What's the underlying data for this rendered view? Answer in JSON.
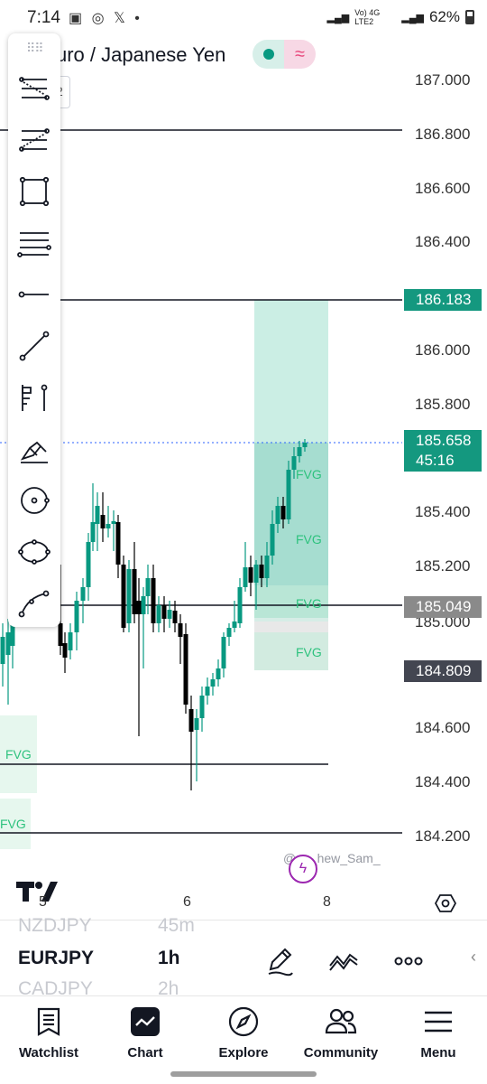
{
  "status_bar": {
    "time": "7:14",
    "signal_text": "Vo) 4G LTE2",
    "battery": "62%"
  },
  "symbol": {
    "title": "uro / Japanese Yen"
  },
  "price_axis": [
    "187.000",
    "186.800",
    "186.600",
    "186.400",
    "186.000",
    "185.800",
    "185.400",
    "185.200",
    "185.000",
    "184.600",
    "184.400",
    "184.200"
  ],
  "price_tags": {
    "target": "186.183",
    "current": "185.658",
    "countdown": "45:16",
    "entry": "185.049",
    "stop": "184.809"
  },
  "fvg_labels": [
    "FVG",
    "FVG",
    "FVG",
    "FVG",
    "FVG",
    "FVG"
  ],
  "time_axis": [
    "5",
    "6",
    "8"
  ],
  "watermark": "@___hew_Sam_",
  "colors": {
    "up": "#089981",
    "down": "#000000",
    "zone": "#089981",
    "fvg": "#2ec27e",
    "brand_pink": "#e8457a"
  },
  "drawing_tools": [
    "fib-retracement-icon",
    "trend-based-fib-icon",
    "rectangle-icon",
    "parallel-lines-icon",
    "horizontal-ray-icon",
    "trend-line-icon",
    "anchored-vwap-icon",
    "brush-icon",
    "circle-target-icon",
    "ellipse-icon",
    "curve-icon"
  ],
  "picker": {
    "prev_symbol": "NZDJPY",
    "prev_interval": "45m",
    "symbol": "EURJPY",
    "interval": "1h",
    "next_symbol": "CADJPY",
    "next_interval": "2h"
  },
  "nav": [
    {
      "label": "Watchlist",
      "icon": "watchlist-icon"
    },
    {
      "label": "Chart",
      "icon": "chart-icon"
    },
    {
      "label": "Explore",
      "icon": "compass-icon"
    },
    {
      "label": "Community",
      "icon": "community-icon"
    },
    {
      "label": "Menu",
      "icon": "menu-icon"
    }
  ]
}
